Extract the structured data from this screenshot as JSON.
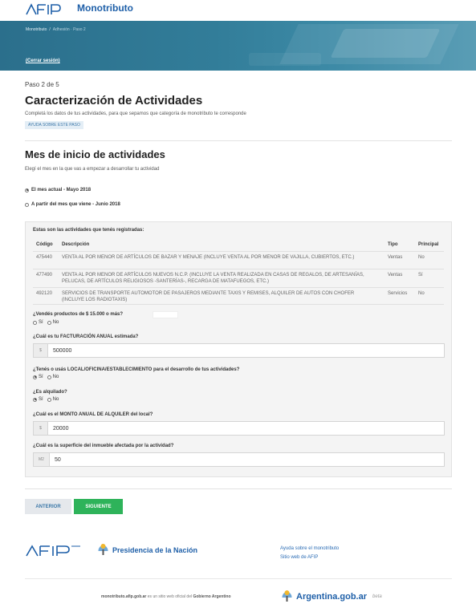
{
  "header": {
    "brand": "Monotributo",
    "logo_text": "AFIP",
    "breadcrumb": {
      "home": "Monotributo",
      "separator": "/",
      "current": "Adhesión · Paso 2"
    },
    "logout": "(Cerrar sesión)"
  },
  "page": {
    "step": "Paso 2 de 5",
    "title": "Caracterización de Actividades",
    "subtitle": "Completá los datos de tus actividades, para que sepamos que categoría de monotributo te corresponde",
    "help_badge": "AYUDA SOBRE ESTE PASO"
  },
  "start_month": {
    "title": "Mes de inicio de actividades",
    "subtitle": "Elegí el mes en la que vas a empezar a desarrollar tu actividad",
    "options": [
      {
        "label": "El mes actual - Mayo 2018",
        "checked": true
      },
      {
        "label": "A partir del mes que viene - Junio 2018",
        "checked": false
      }
    ]
  },
  "activities": {
    "intro": "Estas son las actividades que tenés registradas:",
    "columns": {
      "code": "Código",
      "desc": "Descripción",
      "tipo": "Tipo",
      "principal": "Principal"
    },
    "rows": [
      {
        "code": "475440",
        "desc": "VENTA AL POR MENOR DE ARTÍCULOS DE BAZAR Y MENAJE (INCLUYE VENTA AL POR MENOR DE VAJILLA, CUBIERTOS, ETC.)",
        "tipo": "Ventas",
        "principal": "No"
      },
      {
        "code": "477490",
        "desc": "VENTA AL POR MENOR DE ARTÍCULOS NUEVOS N.C.P. (INCLUYE LA VENTA REALIZADA EN CASAS DE REGALOS, DE ARTESANÍAS, PELUCAS, DE ARTÍCULOS RELIGIOSOS -SANTERÍAS-, RECARGA DE MATAFUEGOS, ETC.)",
        "tipo": "Ventas",
        "principal": "Sí"
      },
      {
        "code": "492120",
        "desc": "SERVICIOS DE TRANSPORTE AUTOMOTOR DE PASAJEROS MEDIANTE TAXIS Y REMISES, ALQUILER DE AUTOS CON CHOFER (INCLUYE LOS RADIOTAXIS)",
        "tipo": "Servicios",
        "principal": "No"
      }
    ]
  },
  "questions": {
    "sell_products": {
      "label": "¿Vendés productos de $ 15.000 o más?",
      "yes": "Sí",
      "no": "No",
      "selected": "none"
    },
    "billing": {
      "label": "¿Cuál es tu FACTURACIÓN ANUAL estimada?",
      "addon": "$",
      "value": "500000"
    },
    "local": {
      "label": "¿Tenés o usás LOCAL/OFICINA/ESTABLECIMIENTO para el desarrollo de tus actividades?",
      "yes": "Sí",
      "no": "No",
      "selected": "yes"
    },
    "rented": {
      "label": "¿Es alquilado?",
      "yes": "Sí",
      "no": "No",
      "selected": "yes"
    },
    "rent_amount": {
      "label": "¿Cuál es el MONTO ANUAL DE ALQUILER del local?",
      "addon": "$",
      "value": "20000"
    },
    "surface": {
      "label": "¿Cuál es la superficie del inmueble afectada por la actividad?",
      "addon": "M2",
      "value": "50"
    }
  },
  "buttons": {
    "back": "ANTERIOR",
    "next": "SIGUIENTE"
  },
  "footer": {
    "afip": "AFIP",
    "nacion": "Presidencia de la Nación",
    "link_help": "Ayuda sobre el monotributo",
    "link_afip": "Sitio web de AFIP",
    "legal_site": "monotributo.afip.gob.ar",
    "legal_mid": " es un sitio web oficial del ",
    "legal_gov": "Gobierno Argentino",
    "argentina": "Argentina.gob.ar",
    "beta": "beta"
  },
  "colors": {
    "accent": "#1e5fa8",
    "hero": "#2b6f8c",
    "next": "#2eb35a"
  }
}
